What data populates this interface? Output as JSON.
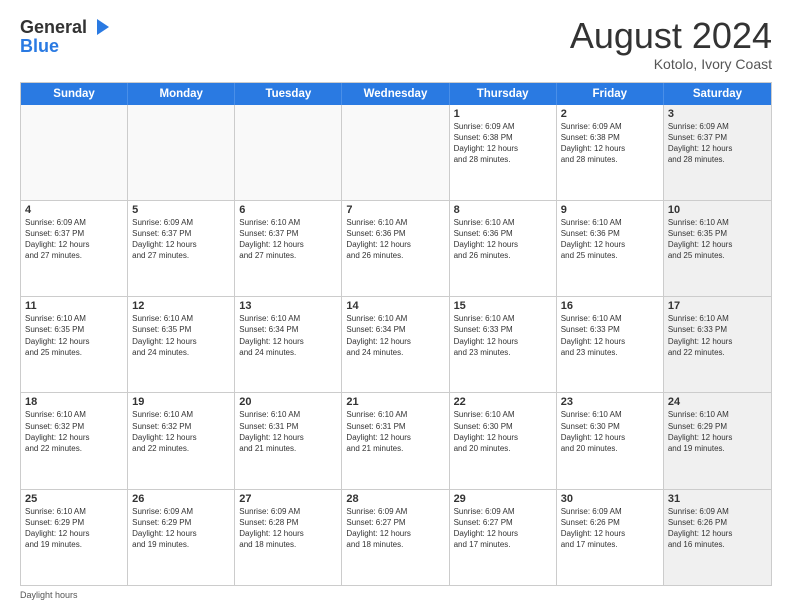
{
  "header": {
    "logo_general": "General",
    "logo_blue": "Blue",
    "month_title": "August 2024",
    "subtitle": "Kotolo, Ivory Coast"
  },
  "days_of_week": [
    "Sunday",
    "Monday",
    "Tuesday",
    "Wednesday",
    "Thursday",
    "Friday",
    "Saturday"
  ],
  "footer": "Daylight hours",
  "weeks": [
    [
      {
        "day": "",
        "info": "",
        "shaded": true,
        "empty": true
      },
      {
        "day": "",
        "info": "",
        "shaded": true,
        "empty": true
      },
      {
        "day": "",
        "info": "",
        "shaded": true,
        "empty": true
      },
      {
        "day": "",
        "info": "",
        "shaded": true,
        "empty": true
      },
      {
        "day": "1",
        "info": "Sunrise: 6:09 AM\nSunset: 6:38 PM\nDaylight: 12 hours\nand 28 minutes.",
        "shaded": false
      },
      {
        "day": "2",
        "info": "Sunrise: 6:09 AM\nSunset: 6:38 PM\nDaylight: 12 hours\nand 28 minutes.",
        "shaded": false
      },
      {
        "day": "3",
        "info": "Sunrise: 6:09 AM\nSunset: 6:37 PM\nDaylight: 12 hours\nand 28 minutes.",
        "shaded": true
      }
    ],
    [
      {
        "day": "4",
        "info": "Sunrise: 6:09 AM\nSunset: 6:37 PM\nDaylight: 12 hours\nand 27 minutes.",
        "shaded": false
      },
      {
        "day": "5",
        "info": "Sunrise: 6:09 AM\nSunset: 6:37 PM\nDaylight: 12 hours\nand 27 minutes.",
        "shaded": false
      },
      {
        "day": "6",
        "info": "Sunrise: 6:10 AM\nSunset: 6:37 PM\nDaylight: 12 hours\nand 27 minutes.",
        "shaded": false
      },
      {
        "day": "7",
        "info": "Sunrise: 6:10 AM\nSunset: 6:36 PM\nDaylight: 12 hours\nand 26 minutes.",
        "shaded": false
      },
      {
        "day": "8",
        "info": "Sunrise: 6:10 AM\nSunset: 6:36 PM\nDaylight: 12 hours\nand 26 minutes.",
        "shaded": false
      },
      {
        "day": "9",
        "info": "Sunrise: 6:10 AM\nSunset: 6:36 PM\nDaylight: 12 hours\nand 25 minutes.",
        "shaded": false
      },
      {
        "day": "10",
        "info": "Sunrise: 6:10 AM\nSunset: 6:35 PM\nDaylight: 12 hours\nand 25 minutes.",
        "shaded": true
      }
    ],
    [
      {
        "day": "11",
        "info": "Sunrise: 6:10 AM\nSunset: 6:35 PM\nDaylight: 12 hours\nand 25 minutes.",
        "shaded": false
      },
      {
        "day": "12",
        "info": "Sunrise: 6:10 AM\nSunset: 6:35 PM\nDaylight: 12 hours\nand 24 minutes.",
        "shaded": false
      },
      {
        "day": "13",
        "info": "Sunrise: 6:10 AM\nSunset: 6:34 PM\nDaylight: 12 hours\nand 24 minutes.",
        "shaded": false
      },
      {
        "day": "14",
        "info": "Sunrise: 6:10 AM\nSunset: 6:34 PM\nDaylight: 12 hours\nand 24 minutes.",
        "shaded": false
      },
      {
        "day": "15",
        "info": "Sunrise: 6:10 AM\nSunset: 6:33 PM\nDaylight: 12 hours\nand 23 minutes.",
        "shaded": false
      },
      {
        "day": "16",
        "info": "Sunrise: 6:10 AM\nSunset: 6:33 PM\nDaylight: 12 hours\nand 23 minutes.",
        "shaded": false
      },
      {
        "day": "17",
        "info": "Sunrise: 6:10 AM\nSunset: 6:33 PM\nDaylight: 12 hours\nand 22 minutes.",
        "shaded": true
      }
    ],
    [
      {
        "day": "18",
        "info": "Sunrise: 6:10 AM\nSunset: 6:32 PM\nDaylight: 12 hours\nand 22 minutes.",
        "shaded": false
      },
      {
        "day": "19",
        "info": "Sunrise: 6:10 AM\nSunset: 6:32 PM\nDaylight: 12 hours\nand 22 minutes.",
        "shaded": false
      },
      {
        "day": "20",
        "info": "Sunrise: 6:10 AM\nSunset: 6:31 PM\nDaylight: 12 hours\nand 21 minutes.",
        "shaded": false
      },
      {
        "day": "21",
        "info": "Sunrise: 6:10 AM\nSunset: 6:31 PM\nDaylight: 12 hours\nand 21 minutes.",
        "shaded": false
      },
      {
        "day": "22",
        "info": "Sunrise: 6:10 AM\nSunset: 6:30 PM\nDaylight: 12 hours\nand 20 minutes.",
        "shaded": false
      },
      {
        "day": "23",
        "info": "Sunrise: 6:10 AM\nSunset: 6:30 PM\nDaylight: 12 hours\nand 20 minutes.",
        "shaded": false
      },
      {
        "day": "24",
        "info": "Sunrise: 6:10 AM\nSunset: 6:29 PM\nDaylight: 12 hours\nand 19 minutes.",
        "shaded": true
      }
    ],
    [
      {
        "day": "25",
        "info": "Sunrise: 6:10 AM\nSunset: 6:29 PM\nDaylight: 12 hours\nand 19 minutes.",
        "shaded": false
      },
      {
        "day": "26",
        "info": "Sunrise: 6:09 AM\nSunset: 6:29 PM\nDaylight: 12 hours\nand 19 minutes.",
        "shaded": false
      },
      {
        "day": "27",
        "info": "Sunrise: 6:09 AM\nSunset: 6:28 PM\nDaylight: 12 hours\nand 18 minutes.",
        "shaded": false
      },
      {
        "day": "28",
        "info": "Sunrise: 6:09 AM\nSunset: 6:27 PM\nDaylight: 12 hours\nand 18 minutes.",
        "shaded": false
      },
      {
        "day": "29",
        "info": "Sunrise: 6:09 AM\nSunset: 6:27 PM\nDaylight: 12 hours\nand 17 minutes.",
        "shaded": false
      },
      {
        "day": "30",
        "info": "Sunrise: 6:09 AM\nSunset: 6:26 PM\nDaylight: 12 hours\nand 17 minutes.",
        "shaded": false
      },
      {
        "day": "31",
        "info": "Sunrise: 6:09 AM\nSunset: 6:26 PM\nDaylight: 12 hours\nand 16 minutes.",
        "shaded": true
      }
    ]
  ]
}
